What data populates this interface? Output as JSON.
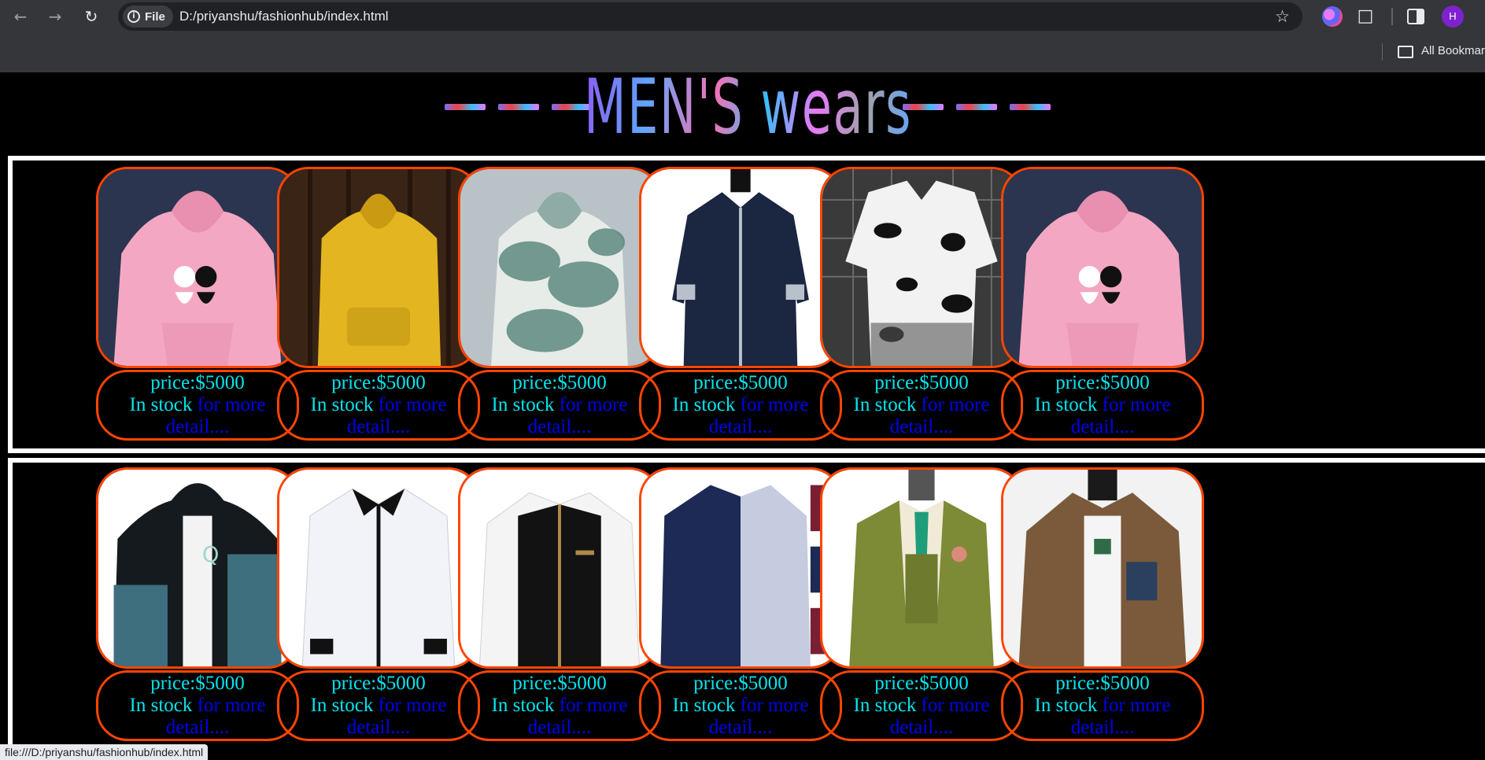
{
  "browser": {
    "file_chip_label": "File",
    "url": "D:/priyanshu/fashionhub/index.html",
    "bookmarks_label": "All Bookmar",
    "profile_initial": "H",
    "status_url": "file:///D:/priyanshu/fashionhub/index.html"
  },
  "page": {
    "banner_title": "MEN'S wears"
  },
  "products": [
    {
      "price": "price:$5000",
      "stock": "In stock",
      "link": "for more detail....",
      "image": "pink-cat-hoodie"
    },
    {
      "price": "price:$5000",
      "stock": "In stock",
      "link": "for more detail....",
      "image": "yellow-hoodie"
    },
    {
      "price": "price:$5000",
      "stock": "In stock",
      "link": "for more detail....",
      "image": "tie-dye-hoodie"
    },
    {
      "price": "price:$5000",
      "stock": "In stock",
      "link": "for more detail....",
      "image": "navy-dress-shirt"
    },
    {
      "price": "price:$5000",
      "stock": "In stock",
      "link": "for more detail....",
      "image": "floral-shirt"
    },
    {
      "price": "price:$5000",
      "stock": "In stock",
      "link": "for more detail....",
      "image": "pink-cat-hoodie"
    },
    {
      "price": "price:$5000",
      "stock": "In stock",
      "link": "for more detail....",
      "image": "teal-black-jacket"
    },
    {
      "price": "price:$5000",
      "stock": "In stock",
      "link": "for more detail....",
      "image": "white-dress-shirt"
    },
    {
      "price": "price:$5000",
      "stock": "In stock",
      "link": "for more detail....",
      "image": "black-white-shirt"
    },
    {
      "price": "price:$5000",
      "stock": "In stock",
      "link": "for more detail....",
      "image": "navy-white-shirt"
    },
    {
      "price": "price:$5000",
      "stock": "In stock",
      "link": "for more detail....",
      "image": "olive-suit"
    },
    {
      "price": "price:$5000",
      "stock": "In stock",
      "link": "for more detail....",
      "image": "brown-jacket"
    }
  ],
  "colors": {
    "card_border": "#ff4500",
    "price_text": "#00e5ee",
    "link_text": "#0000ee",
    "page_background": "#000000"
  }
}
